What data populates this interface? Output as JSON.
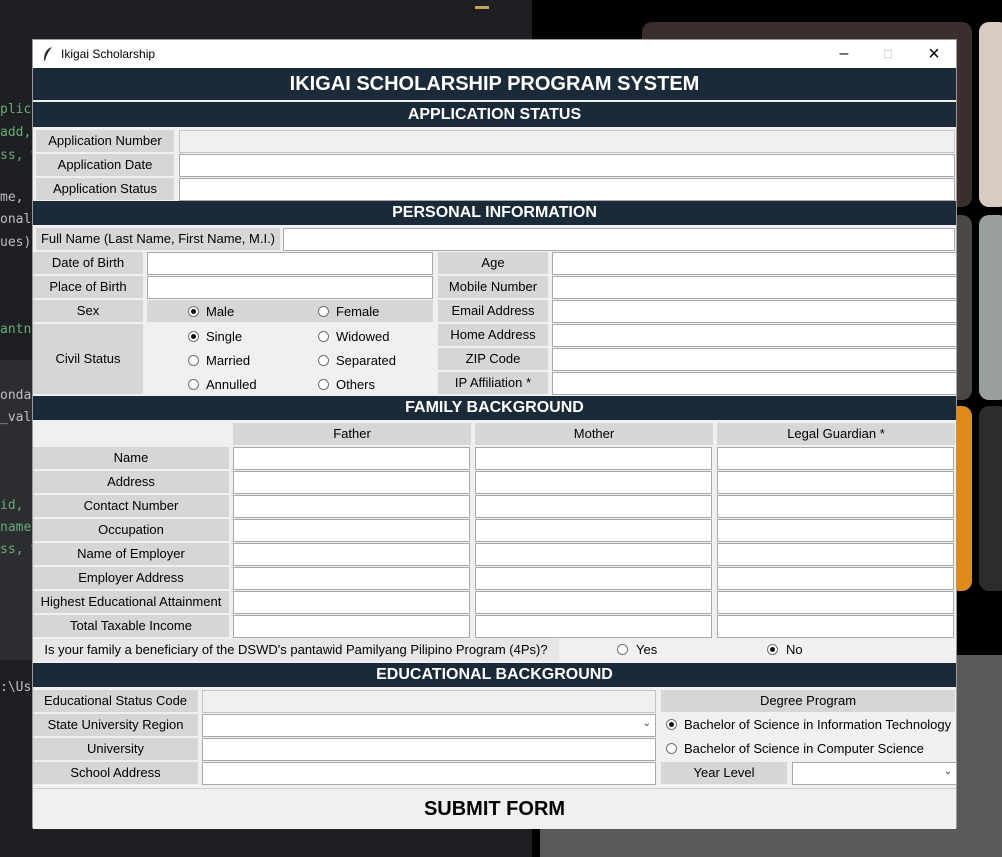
{
  "window": {
    "title": "Ikigai Scholarship",
    "main_heading": "IKIGAI SCHOLARSHIP PROGRAM SYSTEM"
  },
  "code_fragments": [
    "plica",
    "add,",
    "ss, %",
    "me, c",
    "onala",
    "ues)",
    "antno",
    "ondat",
    "_val",
    "id,",
    "name,",
    "ss, %",
    ":\\Use"
  ],
  "sections": {
    "application_status": "APPLICATION STATUS",
    "personal_information": "PERSONAL INFORMATION",
    "family_background": "FAMILY BACKGROUND",
    "educational_background": "EDUCATIONAL BACKGROUND"
  },
  "application": {
    "number_label": "Application Number",
    "date_label": "Application Date",
    "status_label": "Application Status"
  },
  "personal": {
    "full_name_label": "Full Name (Last Name, First Name, M.I.)",
    "dob_label": "Date of Birth",
    "pob_label": "Place of Birth",
    "sex_label": "Sex",
    "civil_status_label": "Civil Status",
    "sex_options": [
      "Male",
      "Female"
    ],
    "sex_selected": "Male",
    "civil_options": [
      "Single",
      "Widowed",
      "Married",
      "Separated",
      "Annulled",
      "Others"
    ],
    "civil_selected": "Single",
    "age_label": "Age",
    "mobile_label": "Mobile Number",
    "email_label": "Email Address",
    "home_label": "Home Address",
    "zip_label": "ZIP Code",
    "ip_label": "IP Affiliation *"
  },
  "family": {
    "columns": [
      "Father",
      "Mother",
      "Legal Guardian *"
    ],
    "rows": [
      "Name",
      "Address",
      "Contact Number",
      "Occupation",
      "Name of Employer",
      "Employer Address",
      "Highest Educational Attainment",
      "Total Taxable Income"
    ],
    "question": "Is your family a beneficiary of the DSWD's pantawid Pamilyang Pilipino Program (4Ps)?",
    "answer_yes": "Yes",
    "answer_no": "No",
    "answer_selected": "No"
  },
  "education": {
    "status_code_label": "Educational Status Code",
    "region_label": "State University Region",
    "university_label": "University",
    "school_address_label": "School Address",
    "degree_label": "Degree Program",
    "degree_options": [
      "Bachelor of Science in Information Technology",
      "Bachelor of Science in Computer Science"
    ],
    "degree_selected": "Bachelor of Science in Information Technology",
    "year_level_label": "Year Level"
  },
  "submit_label": "SUBMIT FORM"
}
